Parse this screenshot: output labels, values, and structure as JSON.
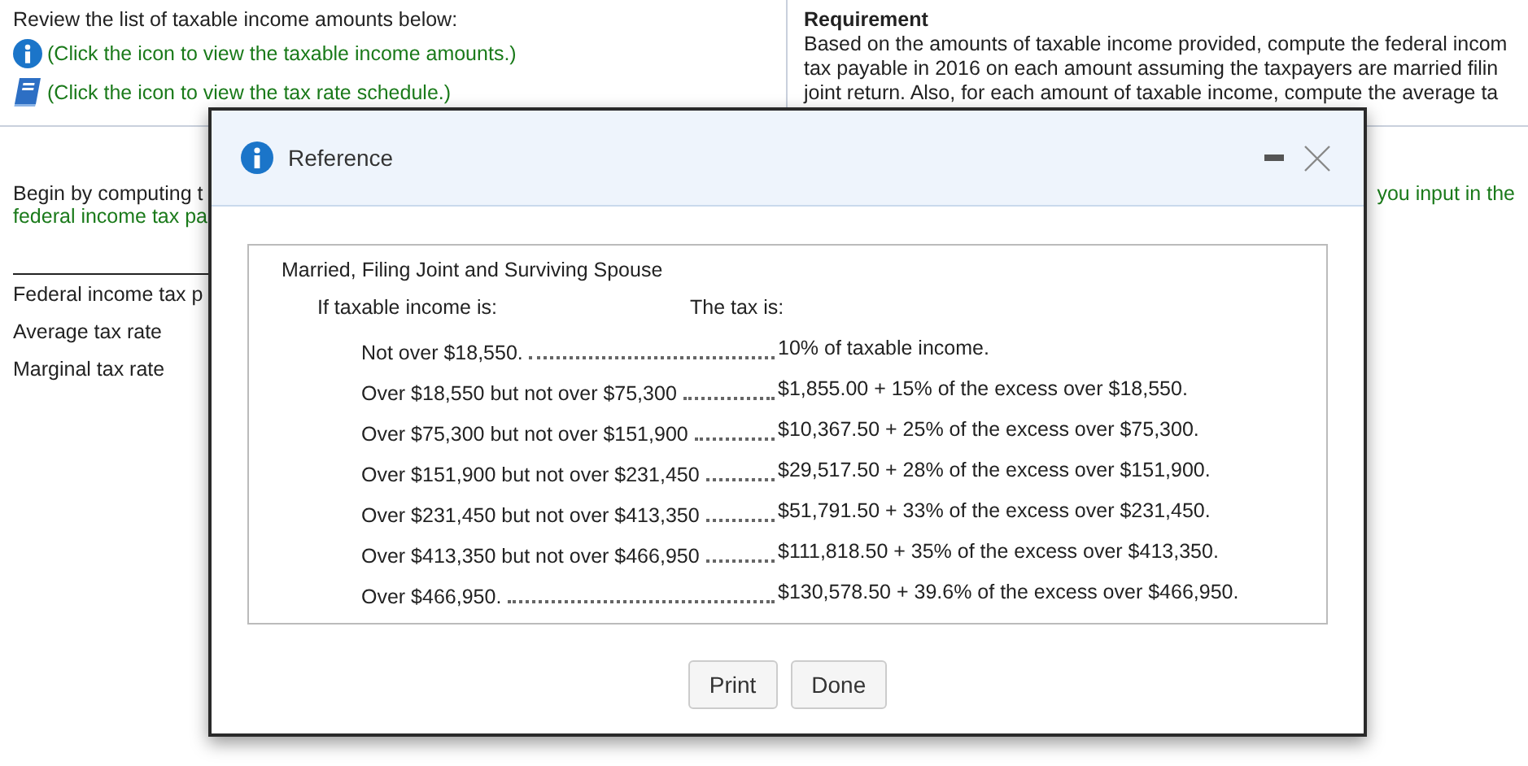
{
  "left_panel": {
    "intro": "Review the list of taxable income amounts below:",
    "links": [
      {
        "kind": "info",
        "text": "(Click the icon to view the taxable income amounts.)"
      },
      {
        "kind": "book",
        "text": "(Click the icon to view the tax rate schedule.)"
      }
    ],
    "instruction_lines": [
      "Begin by computing t",
      "federal income tax pa"
    ],
    "table_rows": [
      "Federal income tax p",
      "Average tax rate",
      "Marginal tax rate"
    ]
  },
  "right_panel": {
    "heading": "Requirement",
    "lines": [
      "Based on the amounts of taxable income provided, compute the federal incom",
      "tax payable in 2016 on each amount assuming the taxpayers are married filin",
      "joint return. Also, for each amount of taxable income, compute the average ta"
    ],
    "instruction_tail": "you input in the"
  },
  "dialog": {
    "title": "Reference",
    "schedule": {
      "title": "Married, Filing Joint and Surviving Spouse",
      "condition_header": "If taxable income is:",
      "tax_header": "The tax is:",
      "rows": [
        {
          "condition": "Not over $18,550.",
          "tax": "10% of taxable income."
        },
        {
          "condition": "Over $18,550 but not over $75,300",
          "tax": "$1,855.00 + 15% of the excess over $18,550."
        },
        {
          "condition": "Over $75,300 but not over $151,900",
          "tax": "$10,367.50 + 25% of the excess over $75,300."
        },
        {
          "condition": "Over $151,900 but not over $231,450",
          "tax": "$29,517.50 + 28% of the excess over $151,900."
        },
        {
          "condition": "Over $231,450 but not over $413,350",
          "tax": "$51,791.50 + 33% of the excess over $231,450."
        },
        {
          "condition": "Over $413,350 but not over $466,950",
          "tax": "$111,818.50 + 35% of the excess over $413,350."
        },
        {
          "condition": "Over $466,950.",
          "tax": "$130,578.50 + 39.6% of the excess over $466,950."
        }
      ]
    },
    "buttons": [
      "Print",
      "Done"
    ]
  }
}
